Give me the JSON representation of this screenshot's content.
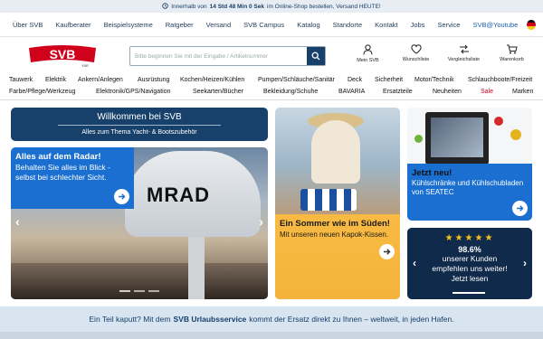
{
  "topbar": {
    "prefix": "Innerhalb von",
    "countdown": "14 Std 48 Min 0 Sek",
    "suffix": "im Online-Shop bestellen, Versand HEUTE!"
  },
  "topnav": [
    "Über SVB",
    "Kaufberater",
    "Beispielsysteme",
    "Ratgeber",
    "Versand",
    "SVB Campus",
    "Katalog",
    "Standorte",
    "Kontakt",
    "Jobs",
    "Service",
    "SVB@Youtube"
  ],
  "header": {
    "logo_text": "SVB",
    "logo_sub": "YAR",
    "search_placeholder": "Bitte beginnen Sie mit der Eingabe / Artikelnummer",
    "icons": [
      {
        "label": "Mein SVB",
        "icon": "user-icon"
      },
      {
        "label": "Wunschliste",
        "icon": "heart-icon"
      },
      {
        "label": "Vergleichsliste",
        "icon": "compare-icon"
      },
      {
        "label": "Warenkorb",
        "icon": "cart-icon"
      }
    ]
  },
  "categories": {
    "row1": [
      "Tauwerk",
      "Elektrik",
      "Ankern/Anlegen",
      "Ausrüstung",
      "Kochen/Heizen/Kühlen",
      "Pumpen/Schläuche/Sanitär",
      "Deck",
      "Sicherheit",
      "Motor/Technik",
      "Schlauchboote/Freizeit"
    ],
    "row2": [
      "Farbe/Pflege/Werkzeug",
      "Elektronik/GPS/Navigation",
      "Seekarten/Bücher",
      "Bekleidung/Schuhe",
      "BAVARIA",
      "Ersatzteile",
      "Neuheiten",
      "Sale",
      "Marken"
    ]
  },
  "welcome": {
    "title": "Willkommen bei SVB",
    "subtitle": "Alles zum Thema Yacht- & Bootszubehör"
  },
  "hero": {
    "title": "Alles auf dem Radar!",
    "text": "Behalten Sie alles im Blick - selbst bei schlechter Sicht.",
    "radar_text": "MRAD"
  },
  "summer": {
    "title": "Ein Sommer wie im Süden!",
    "text": "Mit unseren neuen Kapok-Kissen."
  },
  "fridge": {
    "title": "Jetzt neu!",
    "text": "Kühlschränke und Kühlschubladen von SEATEC"
  },
  "rating": {
    "stars": "★★★★★",
    "pct": "98.6%",
    "line1": "unserer Kunden",
    "line2": "empfehlen uns weiter!",
    "line3": "Jetzt lesen"
  },
  "bottom": {
    "pre": "Ein Teil kaputt? Mit dem",
    "bold": "SVB Urlaubsservice",
    "post": "kommt der Ersatz direkt zu Ihnen – weltweit, in jeden Hafen."
  },
  "colors": {
    "brand": "#17406b",
    "accent": "#1a6fd1",
    "logo_red": "#d0021b",
    "sale": "#d0021b"
  }
}
